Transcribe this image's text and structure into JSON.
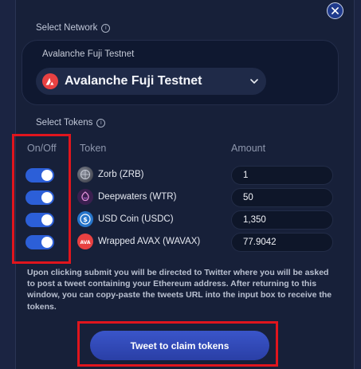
{
  "close_icon": "close-icon",
  "network": {
    "section_label": "Select Network",
    "caption": "Avalanche Fuji Testnet",
    "selected": "Avalanche Fuji Testnet",
    "logo_color": "#e84142"
  },
  "tokens_section": {
    "section_label": "Select Tokens",
    "col_onoff": "On/Off",
    "col_token": "Token",
    "col_amount": "Amount"
  },
  "tokens": [
    {
      "name": "Zorb (ZRB)",
      "amount": "1",
      "enabled": true,
      "icon": "zorb-icon"
    },
    {
      "name": "Deepwaters (WTR)",
      "amount": "50",
      "enabled": true,
      "icon": "deepwaters-icon"
    },
    {
      "name": "USD Coin (USDC)",
      "amount": "1,350",
      "enabled": true,
      "icon": "usdc-icon"
    },
    {
      "name": "Wrapped AVAX (WAVAX)",
      "amount": "77.9042",
      "enabled": true,
      "icon": "wavax-icon"
    }
  ],
  "notice": "Upon clicking submit you will be directed to Twitter where you will be asked to post a tweet containing your Ethereum address. After returning to this window, you can copy-paste the tweets URL into the input box to receive the tokens.",
  "submit_label": "Tweet to claim tokens",
  "colors": {
    "accent": "#2c5fd8",
    "highlight": "#e0151d",
    "background": "#172039"
  }
}
